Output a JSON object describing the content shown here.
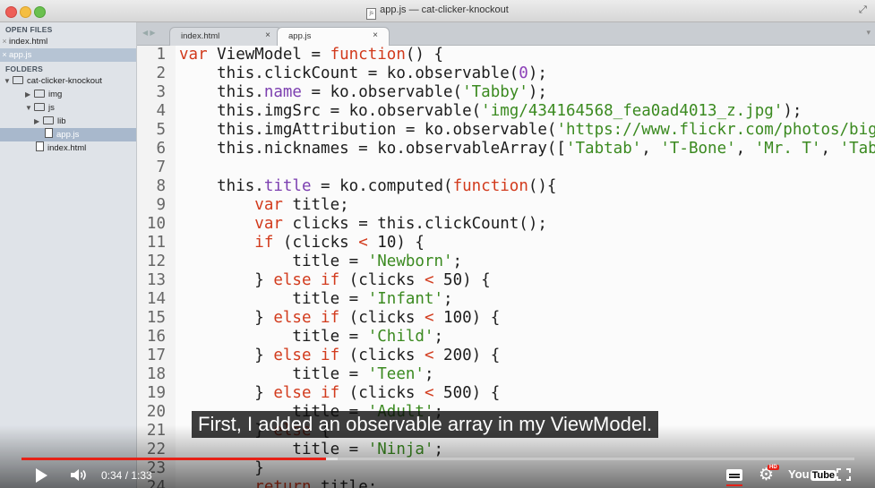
{
  "window": {
    "title": "app.js — cat-clicker-knockout"
  },
  "sidebar": {
    "open_files_header": "OPEN FILES",
    "open_files": [
      {
        "label": "index.html",
        "selected": false
      },
      {
        "label": "app.js",
        "selected": true
      }
    ],
    "folders_header": "FOLDERS",
    "tree": [
      {
        "label": "cat-clicker-knockout",
        "kind": "folder",
        "expanded": true
      },
      {
        "label": "img",
        "kind": "folder",
        "expanded": false
      },
      {
        "label": "js",
        "kind": "folder",
        "expanded": true
      },
      {
        "label": "lib",
        "kind": "folder",
        "expanded": false
      },
      {
        "label": "app.js",
        "kind": "file",
        "selected": true
      },
      {
        "label": "index.html",
        "kind": "file",
        "selected": false
      }
    ]
  },
  "tabs": [
    {
      "label": "index.html",
      "close": "×",
      "active": false
    },
    {
      "label": "app.js",
      "close": "×",
      "active": true
    }
  ],
  "editor": {
    "lines": [
      {
        "n": "1",
        "tokens": [
          [
            "kw",
            "var"
          ],
          [
            "plain",
            " ViewModel = "
          ],
          [
            "fn",
            "function"
          ],
          [
            "plain",
            "() {"
          ]
        ]
      },
      {
        "n": "2",
        "tokens": [
          [
            "plain",
            "    this.clickCount = ko.observable("
          ],
          [
            "lit",
            "0"
          ],
          [
            "plain",
            ");"
          ]
        ]
      },
      {
        "n": "3",
        "tokens": [
          [
            "plain",
            "    this."
          ],
          [
            "prop",
            "name"
          ],
          [
            "plain",
            " = ko.observable("
          ],
          [
            "str",
            "'Tabby'"
          ],
          [
            "plain",
            ");"
          ]
        ]
      },
      {
        "n": "4",
        "tokens": [
          [
            "plain",
            "    this.imgSrc = ko.observable("
          ],
          [
            "str",
            "'img/434164568_fea0ad4013_z.jpg'"
          ],
          [
            "plain",
            ");"
          ]
        ]
      },
      {
        "n": "5",
        "tokens": [
          [
            "plain",
            "    this.imgAttribution = ko.observable("
          ],
          [
            "str",
            "'https://www.flickr.com/photos/big"
          ]
        ]
      },
      {
        "n": "6",
        "tokens": [
          [
            "plain",
            "    this.nicknames = ko.observableArray(["
          ],
          [
            "str",
            "'Tabtab'"
          ],
          [
            "plain",
            ", "
          ],
          [
            "str",
            "'T-Bone'"
          ],
          [
            "plain",
            ", "
          ],
          [
            "str",
            "'Mr. T'"
          ],
          [
            "plain",
            ", "
          ],
          [
            "str",
            "'Tab"
          ]
        ]
      },
      {
        "n": "7",
        "tokens": [
          [
            "plain",
            ""
          ]
        ]
      },
      {
        "n": "8",
        "tokens": [
          [
            "plain",
            "    this."
          ],
          [
            "prop",
            "title"
          ],
          [
            "plain",
            " = ko.computed("
          ],
          [
            "fn",
            "function"
          ],
          [
            "plain",
            "(){"
          ]
        ]
      },
      {
        "n": "9",
        "tokens": [
          [
            "plain",
            "        "
          ],
          [
            "kw",
            "var"
          ],
          [
            "plain",
            " title;"
          ]
        ]
      },
      {
        "n": "10",
        "tokens": [
          [
            "plain",
            "        "
          ],
          [
            "kw",
            "var"
          ],
          [
            "plain",
            " clicks = this.clickCount();"
          ]
        ]
      },
      {
        "n": "11",
        "tokens": [
          [
            "plain",
            "        "
          ],
          [
            "kw",
            "if"
          ],
          [
            "plain",
            " (clicks "
          ],
          [
            "kw",
            "<"
          ],
          [
            "plain",
            " 10) {"
          ]
        ]
      },
      {
        "n": "12",
        "tokens": [
          [
            "plain",
            "            title = "
          ],
          [
            "str",
            "'Newborn'"
          ],
          [
            "plain",
            ";"
          ]
        ]
      },
      {
        "n": "13",
        "tokens": [
          [
            "plain",
            "        } "
          ],
          [
            "kw",
            "else if"
          ],
          [
            "plain",
            " (clicks "
          ],
          [
            "kw",
            "<"
          ],
          [
            "plain",
            " 50) {"
          ]
        ]
      },
      {
        "n": "14",
        "tokens": [
          [
            "plain",
            "            title = "
          ],
          [
            "str",
            "'Infant'"
          ],
          [
            "plain",
            ";"
          ]
        ]
      },
      {
        "n": "15",
        "tokens": [
          [
            "plain",
            "        } "
          ],
          [
            "kw",
            "else if"
          ],
          [
            "plain",
            " (clicks "
          ],
          [
            "kw",
            "<"
          ],
          [
            "plain",
            " 100) {"
          ]
        ]
      },
      {
        "n": "16",
        "tokens": [
          [
            "plain",
            "            title = "
          ],
          [
            "str",
            "'Child'"
          ],
          [
            "plain",
            ";"
          ]
        ]
      },
      {
        "n": "17",
        "tokens": [
          [
            "plain",
            "        } "
          ],
          [
            "kw",
            "else if"
          ],
          [
            "plain",
            " (clicks "
          ],
          [
            "kw",
            "<"
          ],
          [
            "plain",
            " 200) {"
          ]
        ]
      },
      {
        "n": "18",
        "tokens": [
          [
            "plain",
            "            title = "
          ],
          [
            "str",
            "'Teen'"
          ],
          [
            "plain",
            ";"
          ]
        ]
      },
      {
        "n": "19",
        "tokens": [
          [
            "plain",
            "        } "
          ],
          [
            "kw",
            "else if"
          ],
          [
            "plain",
            " (clicks "
          ],
          [
            "kw",
            "<"
          ],
          [
            "plain",
            " 500) {"
          ]
        ]
      },
      {
        "n": "20",
        "tokens": [
          [
            "plain",
            "            title = "
          ],
          [
            "str",
            "'Adult'"
          ],
          [
            "plain",
            ";"
          ]
        ]
      },
      {
        "n": "21",
        "tokens": [
          [
            "plain",
            "        } "
          ],
          [
            "kw",
            "else"
          ],
          [
            "plain",
            " {"
          ]
        ]
      },
      {
        "n": "22",
        "tokens": [
          [
            "plain",
            "            title = "
          ],
          [
            "str",
            "'Ninja'"
          ],
          [
            "plain",
            ";"
          ]
        ]
      },
      {
        "n": "23",
        "tokens": [
          [
            "plain",
            "        }"
          ]
        ]
      },
      {
        "n": "24",
        "tokens": [
          [
            "plain",
            "        "
          ],
          [
            "kw",
            "return"
          ],
          [
            "plain",
            " title;"
          ]
        ]
      }
    ]
  },
  "video": {
    "caption": "First, I added an observable array in my ViewModel.",
    "time_text": "0:34 / 1:33",
    "played_fraction": 0.366,
    "loaded_fraction": 0.38,
    "hd_badge": "HD",
    "logo_you": "You",
    "logo_tube": "Tube",
    "colors": {
      "progress": "#e62117"
    }
  },
  "icons": [
    "play-icon",
    "volume-icon",
    "captions-icon",
    "settings-gear-icon",
    "youtube-logo",
    "fullscreen-icon",
    "close-icon",
    "folder-icon",
    "file-icon"
  ]
}
